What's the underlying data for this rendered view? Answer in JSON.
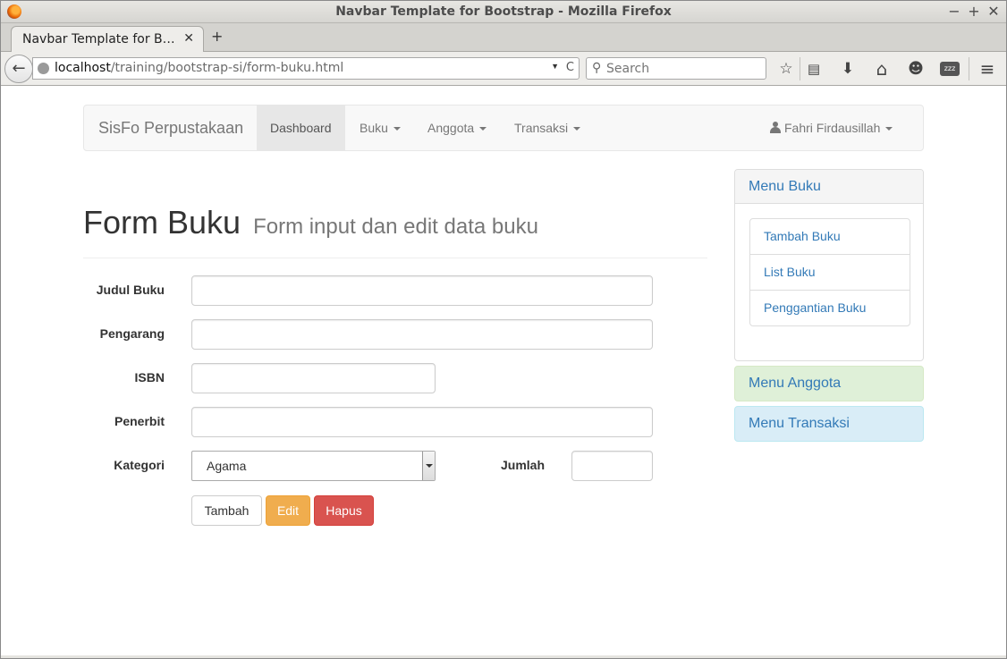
{
  "window": {
    "title": "Navbar Template for Bootstrap - Mozilla Firefox"
  },
  "window_controls": {
    "minimize": "−",
    "maximize": "+",
    "close": "✕"
  },
  "browser": {
    "tab_title": "Navbar Template for B…",
    "tab_close": "✕",
    "new_tab": "+",
    "back": "←",
    "url_host": "localhost",
    "url_path": "/training/bootstrap-si/form-buku.html",
    "url_dropdown": "▼",
    "reload": "C",
    "search_placeholder": "Search",
    "search_glyph": "⚲",
    "toolbar_icons": [
      "bookmark-star-icon",
      "reading-list-icon",
      "download-icon",
      "home-icon",
      "chat-icon",
      "sleep-icon",
      "menu-icon"
    ],
    "toolbar_glyphs": {
      "bookmark": "☆",
      "reading_list": "▤",
      "download": "⬇",
      "home": "⌂",
      "chat": "☻",
      "sleep": "zzz",
      "menu": "≡"
    }
  },
  "navbar": {
    "brand": "SisFo Perpustakaan",
    "items": [
      {
        "label": "Dashboard",
        "active": true,
        "dropdown": false
      },
      {
        "label": "Buku",
        "active": false,
        "dropdown": true
      },
      {
        "label": "Anggota",
        "active": false,
        "dropdown": true
      },
      {
        "label": "Transaksi",
        "active": false,
        "dropdown": true
      }
    ],
    "user": "Fahri Firdausillah"
  },
  "header": {
    "title": "Form Buku",
    "subtitle": "Form input dan edit data buku"
  },
  "form": {
    "fields": [
      {
        "label": "Judul Buku",
        "value": ""
      },
      {
        "label": "Pengarang",
        "value": ""
      },
      {
        "label": "ISBN",
        "value": ""
      },
      {
        "label": "Penerbit",
        "value": ""
      }
    ],
    "kategori": {
      "label": "Kategori",
      "selected": "Agama"
    },
    "jumlah": {
      "label": "Jumlah",
      "value": ""
    },
    "buttons": {
      "tambah": "Tambah",
      "edit": "Edit",
      "hapus": "Hapus"
    }
  },
  "sidebar": {
    "buku": {
      "heading": "Menu Buku",
      "items": [
        "Tambah Buku",
        "List Buku",
        "Penggantian Buku"
      ]
    },
    "anggota": {
      "heading": "Menu Anggota"
    },
    "transaksi": {
      "heading": "Menu Transaksi"
    }
  },
  "colors": {
    "link": "#337ab7",
    "warning": "#f0ad4e",
    "danger": "#d9534f",
    "success_bg": "#dff0d8",
    "info_bg": "#d9edf7"
  }
}
